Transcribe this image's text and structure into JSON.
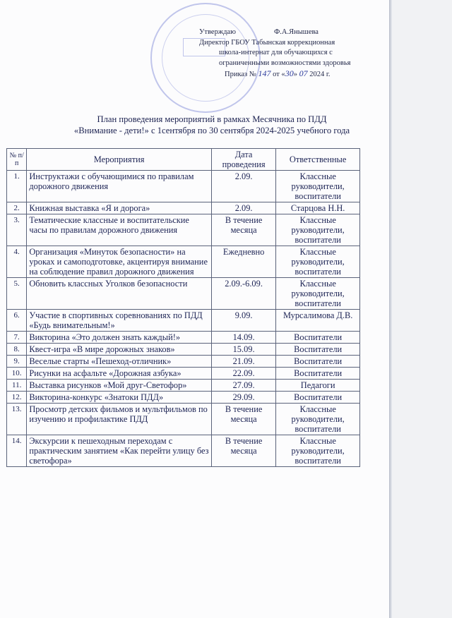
{
  "approval": {
    "line1_prefix": "Утверждаю",
    "line1_name": "Ф.А.Янышева",
    "line2": "Директор ГБОУ Табынская коррекционная",
    "line3": "школа-интернат для обучающихся с",
    "line4": "ограниченными возможностями здоровья",
    "order_prefix": "Приказ № ",
    "order_number": "147",
    "order_from": " от «",
    "order_day": "30",
    "order_mid": "» ",
    "order_month": "07",
    "order_year": " 2024 г."
  },
  "title": {
    "line1": "План проведения мероприятий в рамках Месячника по ПДД",
    "line2": "«Внимание - дети!» с 1сентября по 30 сентября 2024-2025 учебного года"
  },
  "table": {
    "headers": {
      "num": "№ п/п",
      "event": "Мероприятия",
      "date": "Дата проведения",
      "responsible": "Ответственные"
    },
    "rows": [
      {
        "num": "1.",
        "event": "Инструктажи с обучающимися по правилам дорожного движения",
        "date": "2.09.",
        "responsible": "Классные руководители, воспитатели"
      },
      {
        "num": "2.",
        "event": "Книжная выставка «Я и дорога»",
        "date": "2.09.",
        "responsible": "Старцова Н.Н."
      },
      {
        "num": "3.",
        "event": "Тематические классные и воспитательские часы по правилам дорожного движения",
        "date": "В течение месяца",
        "responsible": "Классные руководители, воспитатели"
      },
      {
        "num": "4.",
        "event": "Организация «Минуток безопасности» на уроках и самоподготовке, акцентируя внимание на соблюдение правил дорожного движения",
        "date": "Ежедневно",
        "responsible": "Классные руководители, воспитатели"
      },
      {
        "num": "5.",
        "event": "Обновить классных Уголков безопасности",
        "date": "2.09.-6.09.",
        "responsible": "Классные руководители, воспитатели"
      },
      {
        "num": "6.",
        "event": "Участие в спортивных соревнованиях по ПДД «Будь внимательным!»",
        "date": "9.09.",
        "responsible": "Мурсалимова Д.В."
      },
      {
        "num": "7.",
        "event": "Викторина «Это должен знать каждый!»",
        "date": "14.09.",
        "responsible": "Воспитатели"
      },
      {
        "num": "8.",
        "event": "Квест-игра «В мире дорожных знаков»",
        "date": "15.09.",
        "responsible": "Воспитатели"
      },
      {
        "num": "9.",
        "event": "Веселые старты «Пешеход-отличник»",
        "date": "21.09.",
        "responsible": "Воспитатели"
      },
      {
        "num": "10.",
        "event": "Рисунки на асфальте «Дорожная азбука»",
        "date": "22.09.",
        "responsible": "Воспитатели"
      },
      {
        "num": "11.",
        "event": "Выставка рисунков «Мой друг-Светофор»",
        "date": "27.09.",
        "responsible": "Педагоги"
      },
      {
        "num": "12.",
        "event": "Викторина-конкурс «Знатоки ПДД»",
        "date": "29.09.",
        "responsible": "Воспитатели"
      },
      {
        "num": "13.",
        "event": "Просмотр детских фильмов и мультфильмов по изучению и профилактике ПДД",
        "date": "В течение месяца",
        "responsible": "Классные руководители, воспитатели"
      },
      {
        "num": "14.",
        "event": "Экскурсии к пешеходным переходам с практическим занятием «Как перейти улицу без светофора»",
        "date": "В течение месяца",
        "responsible": "Классные руководители, воспитатели"
      }
    ]
  }
}
